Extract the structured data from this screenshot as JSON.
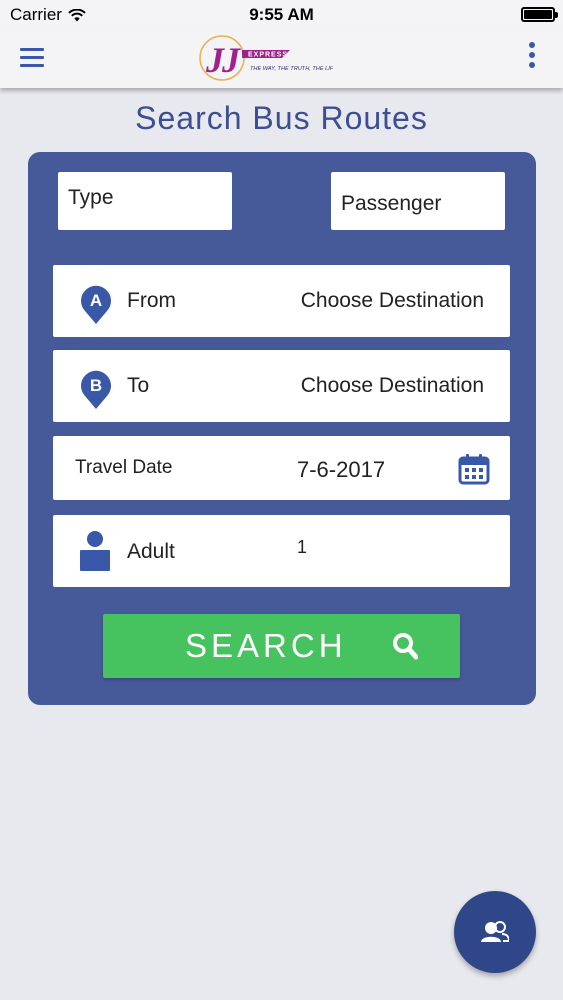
{
  "status_bar": {
    "carrier": "Carrier",
    "time": "9:55 AM"
  },
  "app_bar": {
    "logo_text": "JJ EXPRESS",
    "logo_tagline": "THE WAY, THE TRUTH, THE LIFE",
    "menu_icon": "hamburger-menu-icon",
    "more_icon": "more-vertical-icon"
  },
  "page": {
    "title": "Search Bus Routes"
  },
  "form": {
    "type_label": "Type",
    "passenger_label": "Passenger",
    "from": {
      "pin_letter": "A",
      "label": "From",
      "value": "Choose Destination"
    },
    "to": {
      "pin_letter": "B",
      "label": "To",
      "value": "Choose Destination"
    },
    "travel_date": {
      "label": "Travel Date",
      "value": "7-6-2017",
      "icon": "calendar-icon"
    },
    "adult": {
      "label": "Adult",
      "value": "1",
      "icon": "person-icon"
    },
    "search_button": {
      "label": "SEARCH",
      "icon": "search-icon"
    }
  },
  "fab": {
    "icon": "support-chat-icon"
  },
  "colors": {
    "brand_blue": "#465a99",
    "title_blue": "#3c4f95",
    "search_green": "#46c35f",
    "fab_blue": "#2f4689",
    "logo_magenta": "#a0228c"
  }
}
